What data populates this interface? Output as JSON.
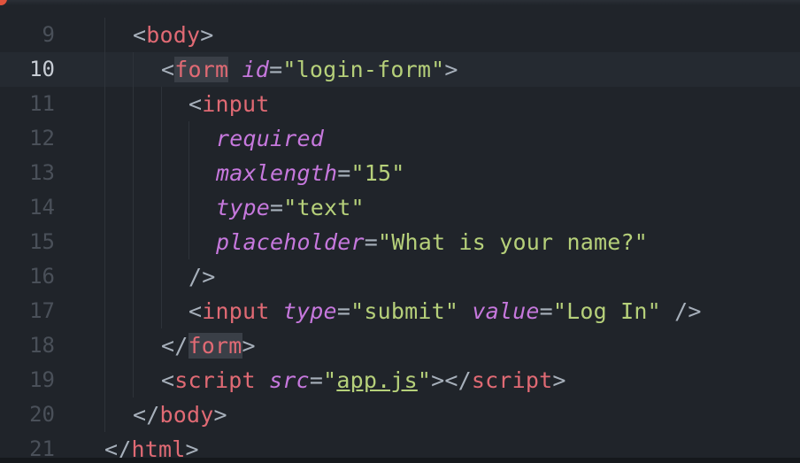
{
  "editor": {
    "language": "HTML",
    "current_line": "10",
    "lines": [
      {
        "num": "9",
        "parts": [
          "<",
          "body",
          ">"
        ]
      },
      {
        "num": "10",
        "parts": [
          "<",
          "form",
          " ",
          "id",
          "=",
          "\"login-form\"",
          ">"
        ]
      },
      {
        "num": "11",
        "parts": [
          "<",
          "input"
        ]
      },
      {
        "num": "12",
        "parts": [
          "required"
        ]
      },
      {
        "num": "13",
        "parts": [
          "maxlength",
          "=",
          "\"15\""
        ]
      },
      {
        "num": "14",
        "parts": [
          "type",
          "=",
          "\"text\""
        ]
      },
      {
        "num": "15",
        "parts": [
          "placeholder",
          "=",
          "\"What is your name?\""
        ]
      },
      {
        "num": "16",
        "parts": [
          "/>"
        ]
      },
      {
        "num": "17",
        "parts": [
          "<",
          "input",
          " ",
          "type",
          "=",
          "\"submit\"",
          " ",
          "value",
          "=",
          "\"Log In\"",
          " />"
        ]
      },
      {
        "num": "18",
        "parts": [
          "</",
          "form",
          ">"
        ]
      },
      {
        "num": "19",
        "parts": [
          "<",
          "script",
          " ",
          "src",
          "=",
          "\"",
          "app.js",
          "\"",
          "></",
          "script",
          ">"
        ]
      },
      {
        "num": "20",
        "parts": [
          "</",
          "body",
          ">"
        ]
      },
      {
        "num": "21",
        "parts": [
          "</",
          "html",
          ">"
        ]
      }
    ]
  },
  "colors": {
    "background": "#20242a",
    "tag": "#e06a74",
    "attribute": "#c678dd",
    "string": "#b6d07a",
    "punctuation": "#a7b0bb",
    "line_number": "#4a5059"
  }
}
